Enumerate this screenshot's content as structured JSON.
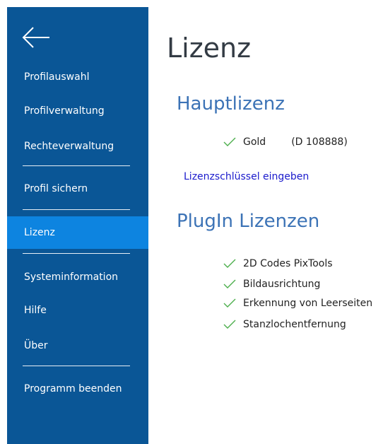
{
  "sidebar": {
    "back_icon": "arrow-left-icon",
    "items": [
      {
        "label": "Profilauswahl"
      },
      {
        "label": "Profilverwaltung"
      },
      {
        "label": "Rechteverwaltung"
      },
      {
        "label": "Profil sichern"
      },
      {
        "label": "Lizenz",
        "active": true
      },
      {
        "label": "Systeminformation"
      },
      {
        "label": "Hilfe"
      },
      {
        "label": "Über"
      },
      {
        "label": "Programm beenden"
      }
    ]
  },
  "main": {
    "title": "Lizenz",
    "main_license": {
      "heading": "Hauptlizenz",
      "name": "Gold",
      "code": "(D 108888)",
      "status_icon": "check-icon"
    },
    "enter_key_link": "Lizenzschlüssel eingeben",
    "plugins": {
      "heading": "PlugIn Lizenzen",
      "items": [
        {
          "label": "2D Codes PixTools"
        },
        {
          "label": "Bildausrichtung"
        },
        {
          "label": "Erkennung von Leerseiten"
        },
        {
          "label": "Stanzlochentfernung"
        }
      ]
    }
  },
  "colors": {
    "sidebar_bg": "#0a5696",
    "active_item_bg": "#0d84e0",
    "section_heading": "#3c73b6",
    "check": "#4cae4c",
    "link": "#1a1acc"
  }
}
